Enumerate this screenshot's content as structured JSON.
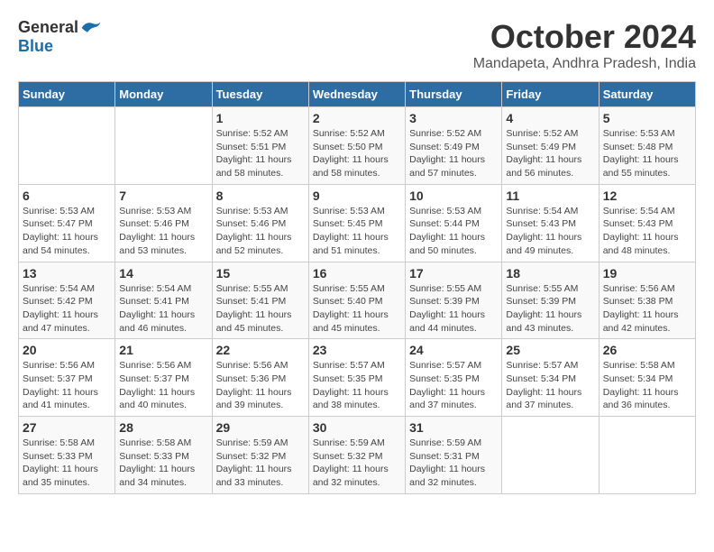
{
  "header": {
    "logo_general": "General",
    "logo_blue": "Blue",
    "title": "October 2024",
    "location": "Mandapeta, Andhra Pradesh, India"
  },
  "days_of_week": [
    "Sunday",
    "Monday",
    "Tuesday",
    "Wednesday",
    "Thursday",
    "Friday",
    "Saturday"
  ],
  "weeks": [
    [
      {
        "day": "",
        "info": ""
      },
      {
        "day": "",
        "info": ""
      },
      {
        "day": "1",
        "info": "Sunrise: 5:52 AM\nSunset: 5:51 PM\nDaylight: 11 hours and 58 minutes."
      },
      {
        "day": "2",
        "info": "Sunrise: 5:52 AM\nSunset: 5:50 PM\nDaylight: 11 hours and 58 minutes."
      },
      {
        "day": "3",
        "info": "Sunrise: 5:52 AM\nSunset: 5:49 PM\nDaylight: 11 hours and 57 minutes."
      },
      {
        "day": "4",
        "info": "Sunrise: 5:52 AM\nSunset: 5:49 PM\nDaylight: 11 hours and 56 minutes."
      },
      {
        "day": "5",
        "info": "Sunrise: 5:53 AM\nSunset: 5:48 PM\nDaylight: 11 hours and 55 minutes."
      }
    ],
    [
      {
        "day": "6",
        "info": "Sunrise: 5:53 AM\nSunset: 5:47 PM\nDaylight: 11 hours and 54 minutes."
      },
      {
        "day": "7",
        "info": "Sunrise: 5:53 AM\nSunset: 5:46 PM\nDaylight: 11 hours and 53 minutes."
      },
      {
        "day": "8",
        "info": "Sunrise: 5:53 AM\nSunset: 5:46 PM\nDaylight: 11 hours and 52 minutes."
      },
      {
        "day": "9",
        "info": "Sunrise: 5:53 AM\nSunset: 5:45 PM\nDaylight: 11 hours and 51 minutes."
      },
      {
        "day": "10",
        "info": "Sunrise: 5:53 AM\nSunset: 5:44 PM\nDaylight: 11 hours and 50 minutes."
      },
      {
        "day": "11",
        "info": "Sunrise: 5:54 AM\nSunset: 5:43 PM\nDaylight: 11 hours and 49 minutes."
      },
      {
        "day": "12",
        "info": "Sunrise: 5:54 AM\nSunset: 5:43 PM\nDaylight: 11 hours and 48 minutes."
      }
    ],
    [
      {
        "day": "13",
        "info": "Sunrise: 5:54 AM\nSunset: 5:42 PM\nDaylight: 11 hours and 47 minutes."
      },
      {
        "day": "14",
        "info": "Sunrise: 5:54 AM\nSunset: 5:41 PM\nDaylight: 11 hours and 46 minutes."
      },
      {
        "day": "15",
        "info": "Sunrise: 5:55 AM\nSunset: 5:41 PM\nDaylight: 11 hours and 45 minutes."
      },
      {
        "day": "16",
        "info": "Sunrise: 5:55 AM\nSunset: 5:40 PM\nDaylight: 11 hours and 45 minutes."
      },
      {
        "day": "17",
        "info": "Sunrise: 5:55 AM\nSunset: 5:39 PM\nDaylight: 11 hours and 44 minutes."
      },
      {
        "day": "18",
        "info": "Sunrise: 5:55 AM\nSunset: 5:39 PM\nDaylight: 11 hours and 43 minutes."
      },
      {
        "day": "19",
        "info": "Sunrise: 5:56 AM\nSunset: 5:38 PM\nDaylight: 11 hours and 42 minutes."
      }
    ],
    [
      {
        "day": "20",
        "info": "Sunrise: 5:56 AM\nSunset: 5:37 PM\nDaylight: 11 hours and 41 minutes."
      },
      {
        "day": "21",
        "info": "Sunrise: 5:56 AM\nSunset: 5:37 PM\nDaylight: 11 hours and 40 minutes."
      },
      {
        "day": "22",
        "info": "Sunrise: 5:56 AM\nSunset: 5:36 PM\nDaylight: 11 hours and 39 minutes."
      },
      {
        "day": "23",
        "info": "Sunrise: 5:57 AM\nSunset: 5:35 PM\nDaylight: 11 hours and 38 minutes."
      },
      {
        "day": "24",
        "info": "Sunrise: 5:57 AM\nSunset: 5:35 PM\nDaylight: 11 hours and 37 minutes."
      },
      {
        "day": "25",
        "info": "Sunrise: 5:57 AM\nSunset: 5:34 PM\nDaylight: 11 hours and 37 minutes."
      },
      {
        "day": "26",
        "info": "Sunrise: 5:58 AM\nSunset: 5:34 PM\nDaylight: 11 hours and 36 minutes."
      }
    ],
    [
      {
        "day": "27",
        "info": "Sunrise: 5:58 AM\nSunset: 5:33 PM\nDaylight: 11 hours and 35 minutes."
      },
      {
        "day": "28",
        "info": "Sunrise: 5:58 AM\nSunset: 5:33 PM\nDaylight: 11 hours and 34 minutes."
      },
      {
        "day": "29",
        "info": "Sunrise: 5:59 AM\nSunset: 5:32 PM\nDaylight: 11 hours and 33 minutes."
      },
      {
        "day": "30",
        "info": "Sunrise: 5:59 AM\nSunset: 5:32 PM\nDaylight: 11 hours and 32 minutes."
      },
      {
        "day": "31",
        "info": "Sunrise: 5:59 AM\nSunset: 5:31 PM\nDaylight: 11 hours and 32 minutes."
      },
      {
        "day": "",
        "info": ""
      },
      {
        "day": "",
        "info": ""
      }
    ]
  ]
}
